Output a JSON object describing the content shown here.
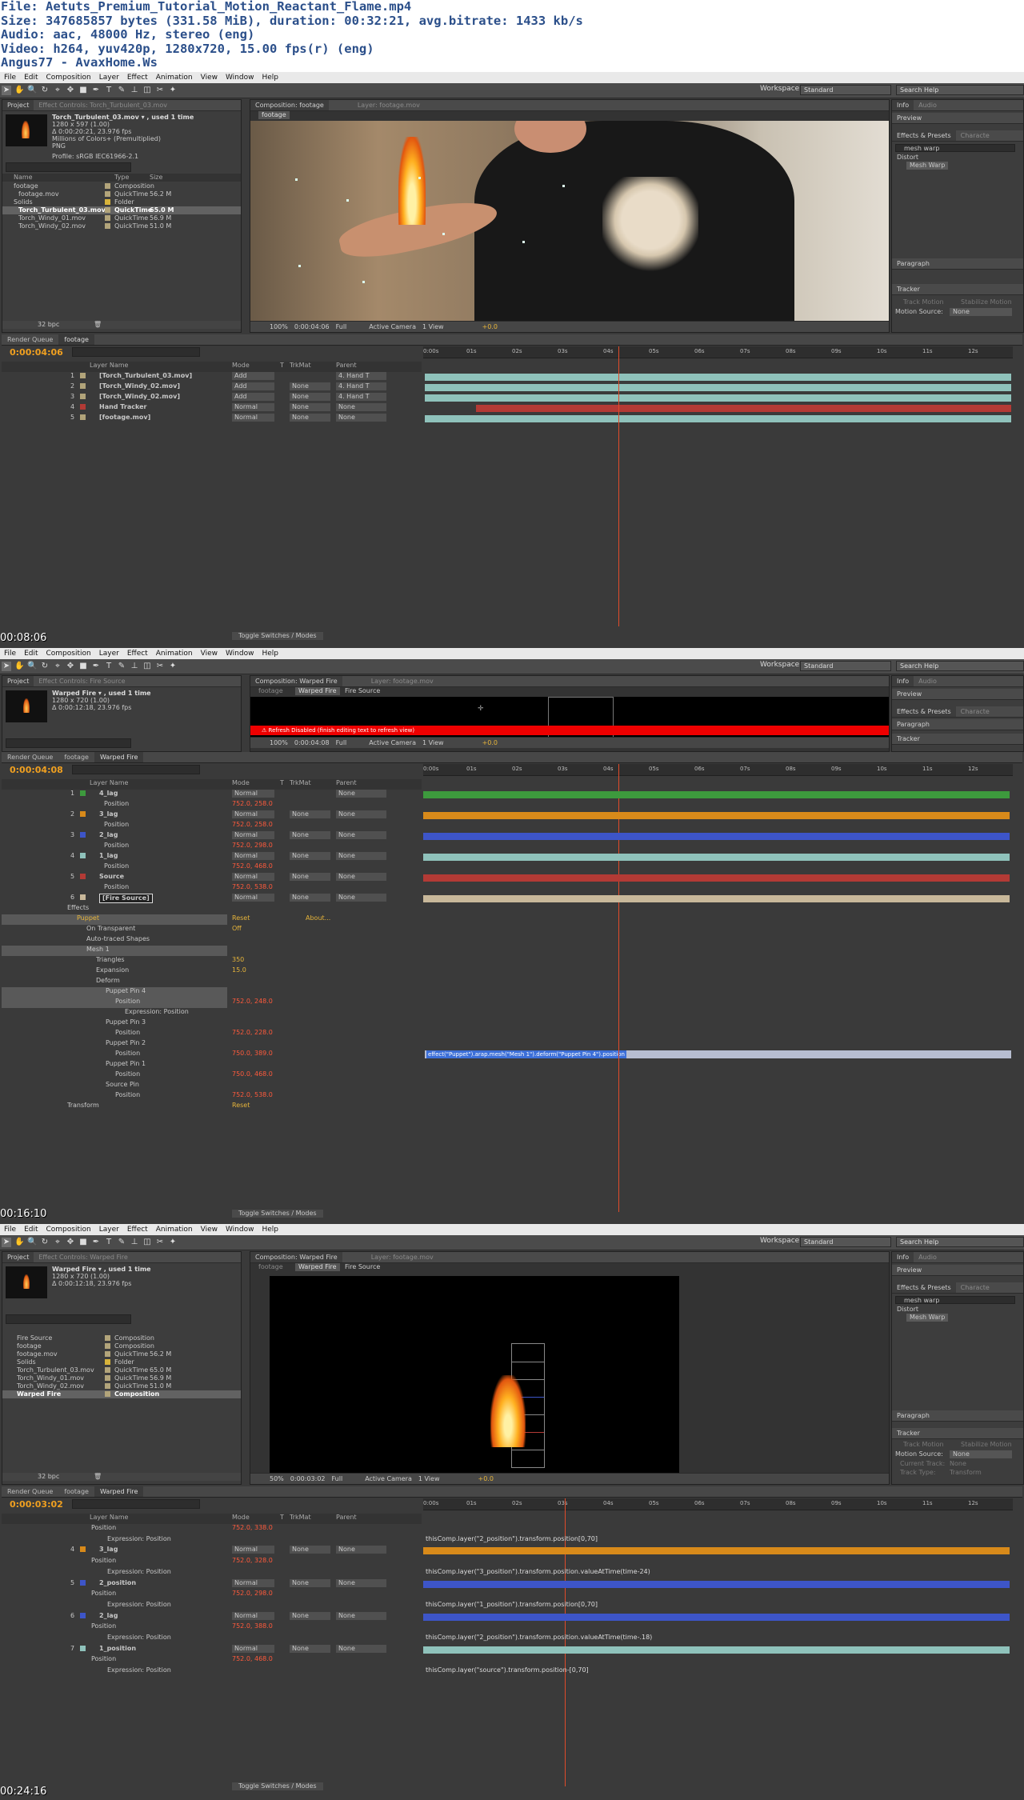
{
  "header": {
    "line1": "File: Aetuts_Premium_Tutorial_Motion_Reactant_Flame.mp4",
    "line2": "Size: 347685857 bytes (331.58 MiB), duration: 00:32:21, avg.bitrate: 1433 kb/s",
    "line3": "Audio: aac, 48000 Hz, stereo (eng)",
    "line4": "Video: h264, yuv420p, 1280x720, 15.00 fps(r) (eng)",
    "line5": "Angus77 - AvaxHome.Ws"
  },
  "menu": [
    "File",
    "Edit",
    "Composition",
    "Layer",
    "Effect",
    "Animation",
    "View",
    "Window",
    "Help"
  ],
  "workspace_label": "Workspace:",
  "workspace_value": "Standard",
  "search_help": "Search Help",
  "frames": [
    {
      "stamp": "00:08:06",
      "project_tab": "Project",
      "effect_tab": "Effect Controls: Torch_Turbulent_03.mov",
      "info": {
        "name": "Torch_Turbulent_03.mov ▾ , used 1 time",
        "l1": "1280 x 597 (1.00)",
        "l2": "Δ 0:00:20:21, 23.976 fps",
        "l3": "Millions of Colors+ (Premultiplied)",
        "l4": "PNG",
        "l5": "Profile: sRGB IEC61966-2.1"
      },
      "project_cols": [
        "Name",
        "Type",
        "Size"
      ],
      "project_items": [
        {
          "name": "footage",
          "type": "Composition",
          "size": ""
        },
        {
          "name": "footage.mov",
          "type": "QuickTime",
          "size": "56.2 M"
        },
        {
          "name": "Solids",
          "type": "Folder",
          "size": ""
        },
        {
          "name": "Torch_Turbulent_03.mov",
          "type": "QuickTime",
          "size": "65.0 M"
        },
        {
          "name": "Torch_Windy_01.mov",
          "type": "QuickTime",
          "size": "56.9 M"
        },
        {
          "name": "Torch_Windy_02.mov",
          "type": "QuickTime",
          "size": "51.0 M"
        }
      ],
      "bpc": "32 bpc",
      "comp_tab": "Composition: footage",
      "layer_tab": "Layer: footage.mov",
      "comp_subtab": "footage",
      "viewer_bar": [
        "100%",
        "0:00:04:06",
        "Full",
        "Active Camera",
        "1 View",
        "+0.0"
      ],
      "right_tabs": {
        "info": "Info",
        "audio": "Audio",
        "preview": "Preview",
        "effects": "Effects & Presets",
        "char": "Characte",
        "para": "Paragraph",
        "tracker": "Tracker"
      },
      "effects_search": "mesh warp",
      "effects_tree": [
        "Distort",
        "Mesh Warp"
      ],
      "tracker_items": [
        "Track Motion",
        "Stabilize Motion",
        "Motion Source:",
        "None"
      ],
      "tl_tabs": [
        "Render Queue",
        "footage"
      ],
      "timecode": "0:00:04:06",
      "ruler": [
        "0:00s",
        "01s",
        "02s",
        "03s",
        "04s",
        "05s",
        "06s",
        "07s",
        "08s",
        "09s",
        "10s",
        "11s",
        "12s"
      ],
      "col_hdr": {
        "name": "Layer Name",
        "mode": "Mode",
        "t": "T",
        "trk": "TrkMat",
        "parent": "Parent"
      },
      "layers": [
        {
          "num": "1",
          "name": "[Torch_Turbulent_03.mov]",
          "mode": "Add",
          "trk": "",
          "parent": "4. Hand T"
        },
        {
          "num": "2",
          "name": "[Torch_Windy_02.mov]",
          "mode": "Add",
          "trk": "None",
          "parent": "4. Hand T"
        },
        {
          "num": "3",
          "name": "[Torch_Windy_02.mov]",
          "mode": "Add",
          "trk": "None",
          "parent": "4. Hand T"
        },
        {
          "num": "4",
          "name": "Hand Tracker",
          "mode": "Normal",
          "trk": "None",
          "parent": "None"
        },
        {
          "num": "5",
          "name": "[footage.mov]",
          "mode": "Normal",
          "trk": "None",
          "parent": "None"
        }
      ],
      "toggle": "Toggle Switches / Modes"
    },
    {
      "stamp": "00:16:10",
      "project_tab": "Project",
      "effect_tab": "Effect Controls: Fire Source",
      "info": {
        "name": "Warped Fire ▾ , used 1 time",
        "l1": "1280 x 720 (1.00)",
        "l2": "Δ 0:00:12:18, 23.976 fps"
      },
      "comp_tab": "Composition: Warped Fire",
      "layer_tab": "Layer: footage.mov",
      "comp_subtabs": [
        "footage",
        "Warped Fire",
        "Fire Source"
      ],
      "warning": "Refresh Disabled (finish editing text to refresh view)",
      "viewer_bar": [
        "100%",
        "0:00:04:08",
        "Full",
        "Active Camera",
        "1 View",
        "+0.0"
      ],
      "tl_tabs": [
        "Render Queue",
        "footage",
        "Warped Fire"
      ],
      "timecode": "0:00:04:08",
      "ruler": [
        "0:00s",
        "01s",
        "02s",
        "03s",
        "04s",
        "05s",
        "06s",
        "07s",
        "08s",
        "09s",
        "10s",
        "11s",
        "12s"
      ],
      "rows": [
        {
          "num": "1",
          "name": "4_lag",
          "mode": "Normal",
          "trk": "",
          "parent": "None",
          "color": "#3d9a3d"
        },
        {
          "name": "Position",
          "val": "752.0, 258.0"
        },
        {
          "num": "2",
          "name": "3_lag",
          "mode": "Normal",
          "trk": "None",
          "parent": "None",
          "color": "#d88a1a"
        },
        {
          "name": "Position",
          "val": "752.0, 258.0"
        },
        {
          "num": "3",
          "name": "2_lag",
          "mode": "Normal",
          "trk": "None",
          "parent": "None",
          "color": "#3d55c8"
        },
        {
          "name": "Position",
          "val": "752.0, 298.0"
        },
        {
          "num": "4",
          "name": "1_lag",
          "mode": "Normal",
          "trk": "None",
          "parent": "None",
          "color": "#8fc2bb"
        },
        {
          "name": "Position",
          "val": "752.0, 468.0"
        },
        {
          "num": "5",
          "name": "Source",
          "mode": "Normal",
          "trk": "None",
          "parent": "None",
          "color": "#b33a35"
        },
        {
          "name": "Position",
          "val": "752.0, 538.0"
        },
        {
          "num": "6",
          "name": "[Fire Source]",
          "mode": "Normal",
          "trk": "None",
          "parent": "None",
          "color": "#c8b89a"
        }
      ],
      "effects_rows": [
        {
          "indent": 1,
          "name": "Effects"
        },
        {
          "indent": 2,
          "name": "Puppet",
          "val": "Reset",
          "val2": "About..."
        },
        {
          "indent": 3,
          "name": "On Transparent",
          "val": "Off"
        },
        {
          "indent": 3,
          "name": "Auto-traced Shapes"
        },
        {
          "indent": 3,
          "name": "Mesh 1"
        },
        {
          "indent": 4,
          "name": "Triangles",
          "val": "350"
        },
        {
          "indent": 4,
          "name": "Expansion",
          "val": "15.0"
        },
        {
          "indent": 4,
          "name": "Deform"
        },
        {
          "indent": 5,
          "name": "Puppet Pin 4"
        },
        {
          "indent": 6,
          "name": "Position",
          "val": "752.0, 248.0"
        },
        {
          "indent": 7,
          "name": "Expression: Position"
        },
        {
          "indent": 5,
          "name": "Puppet Pin 3"
        },
        {
          "indent": 6,
          "name": "Position",
          "val": "752.0, 228.0"
        },
        {
          "indent": 5,
          "name": "Puppet Pin 2"
        },
        {
          "indent": 6,
          "name": "Position",
          "val": "750.0, 389.0"
        },
        {
          "indent": 5,
          "name": "Puppet Pin 1"
        },
        {
          "indent": 6,
          "name": "Position",
          "val": "750.0, 468.0"
        },
        {
          "indent": 5,
          "name": "Source Pin"
        },
        {
          "indent": 6,
          "name": "Position",
          "val": "752.0, 538.0"
        },
        {
          "indent": 1,
          "name": "Transform",
          "val": "Reset"
        }
      ],
      "expression": "effect(\"Puppet\").arap.mesh(\"Mesh 1\").deform(\"Puppet Pin 4\").position",
      "toggle": "Toggle Switches / Modes"
    },
    {
      "stamp": "00:24:16",
      "project_tab": "Project",
      "effect_tab": "Effect Controls: Warped Fire",
      "info": {
        "name": "Warped Fire ▾ , used 1 time",
        "l1": "1280 x 720 (1.00)",
        "l2": "Δ 0:00:12:18, 23.976 fps"
      },
      "project_items": [
        {
          "name": "Fire Source",
          "type": "Composition",
          "size": ""
        },
        {
          "name": "footage",
          "type": "Composition",
          "size": ""
        },
        {
          "name": "footage.mov",
          "type": "QuickTime",
          "size": "56.2 M"
        },
        {
          "name": "Solids",
          "type": "Folder",
          "size": ""
        },
        {
          "name": "Torch_Turbulent_03.mov",
          "type": "QuickTime",
          "size": "65.0 M"
        },
        {
          "name": "Torch_Windy_01.mov",
          "type": "QuickTime",
          "size": "56.9 M"
        },
        {
          "name": "Torch_Windy_02.mov",
          "type": "QuickTime",
          "size": "51.0 M"
        },
        {
          "name": "Warped Fire",
          "type": "Composition",
          "size": ""
        }
      ],
      "bpc": "32 bpc",
      "comp_tab": "Composition: Warped Fire",
      "layer_tab": "Layer: footage.mov",
      "comp_subtabs": [
        "footage",
        "Warped Fire",
        "Fire Source"
      ],
      "viewer_bar": [
        "50%",
        "0:00:03:02",
        "Full",
        "Active Camera",
        "1 View",
        "+0.0"
      ],
      "tracker_items": [
        "Track Motion",
        "Stabilize Motion",
        "Motion Source:",
        "None",
        "Current Track:",
        "None",
        "Track Type:",
        "Transform"
      ],
      "tl_tabs": [
        "Render Queue",
        "footage",
        "Warped Fire"
      ],
      "timecode": "0:00:03:02",
      "ruler": [
        "0:00s",
        "01s",
        "02s",
        "03s",
        "04s",
        "05s",
        "06s",
        "07s",
        "08s",
        "09s",
        "10s",
        "11s",
        "12s"
      ],
      "rows": [
        {
          "name": "Position",
          "val": "752.0, 338.0",
          "sub": true
        },
        {
          "name": "Expression: Position",
          "expr": "thisComp.layer(\"2_position\").transform.position[0,70]",
          "sub": true
        },
        {
          "num": "4",
          "name": "3_lag",
          "mode": "Normal",
          "trk": "None",
          "parent": "None",
          "color": "#d88a1a"
        },
        {
          "name": "Position",
          "val": "752.0, 328.0",
          "sub": true
        },
        {
          "name": "Expression: Position",
          "expr": "thisComp.layer(\"3_position\").transform.position.valueAtTime(time-24)",
          "sub": true
        },
        {
          "num": "5",
          "name": "2_position",
          "mode": "Normal",
          "trk": "None",
          "parent": "None",
          "color": "#3d55c8"
        },
        {
          "name": "Position",
          "val": "752.0, 298.0",
          "sub": true
        },
        {
          "name": "Expression: Position",
          "expr": "thisComp.layer(\"1_position\").transform.position[0,70]",
          "sub": true
        },
        {
          "num": "6",
          "name": "2_lag",
          "mode": "Normal",
          "trk": "None",
          "parent": "None",
          "color": "#3d55c8"
        },
        {
          "name": "Position",
          "val": "752.0, 388.0",
          "sub": true
        },
        {
          "name": "Expression: Position",
          "expr": "thisComp.layer(\"2_position\").transform.position.valueAtTime(time-.18)",
          "sub": true
        },
        {
          "num": "7",
          "name": "1_position",
          "mode": "Normal",
          "trk": "None",
          "parent": "None",
          "color": "#8fc2bb"
        },
        {
          "name": "Position",
          "val": "752.0, 468.0",
          "sub": true
        },
        {
          "name": "Expression: Position",
          "expr": "thisComp.layer(\"source\").transform.position-[0,70]",
          "sub": true
        }
      ],
      "toggle": "Toggle Switches / Modes"
    }
  ]
}
